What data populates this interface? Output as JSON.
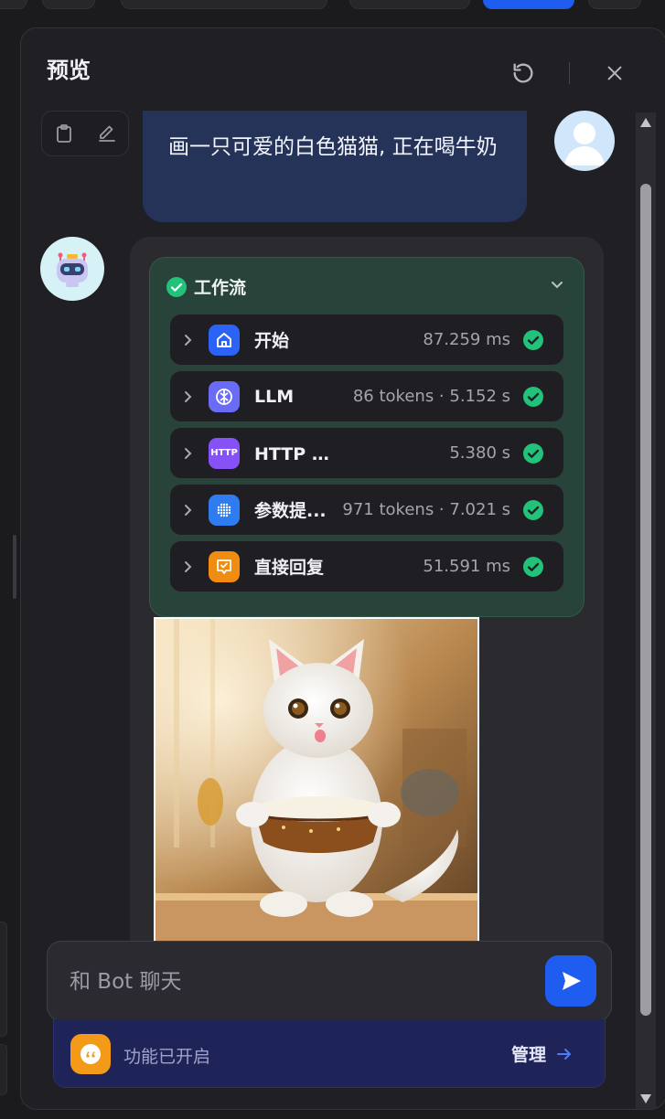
{
  "panel": {
    "title": "预览"
  },
  "user_message": {
    "text": "画一只可爱的白色猫猫, 正在喝牛奶"
  },
  "workflow": {
    "title": "工作流",
    "nodes": [
      {
        "name": "开始",
        "meta": "87.259 ms",
        "icon": "home-icon",
        "color": "#2b63f6"
      },
      {
        "name": "LLM",
        "meta": "86 tokens · 5.152 s",
        "icon": "brain-icon",
        "color": "#6b6cf5"
      },
      {
        "name": "HTTP 请求",
        "meta": "5.380 s",
        "icon": "http-icon",
        "icon_text": "HTTP",
        "color": "#8752f5"
      },
      {
        "name": "参数提...",
        "meta": "971 tokens · 7.021 s",
        "icon": "dots-grid-icon",
        "color": "#2f7cf0"
      },
      {
        "name": "直接回复",
        "meta": "51.591 ms",
        "icon": "reply-icon",
        "color": "#f08c10"
      }
    ]
  },
  "image": {
    "subject": "white kitten holding a bowl of milk"
  },
  "chat_input": {
    "placeholder": "和 Bot 聊天"
  },
  "feature_bar": {
    "status": "功能已开启",
    "manage_label": "管理"
  },
  "colors": {
    "accent": "#1f5cf0",
    "success": "#22c27a",
    "user_bubble": "#263359",
    "workflow_bg": "#28433a"
  }
}
